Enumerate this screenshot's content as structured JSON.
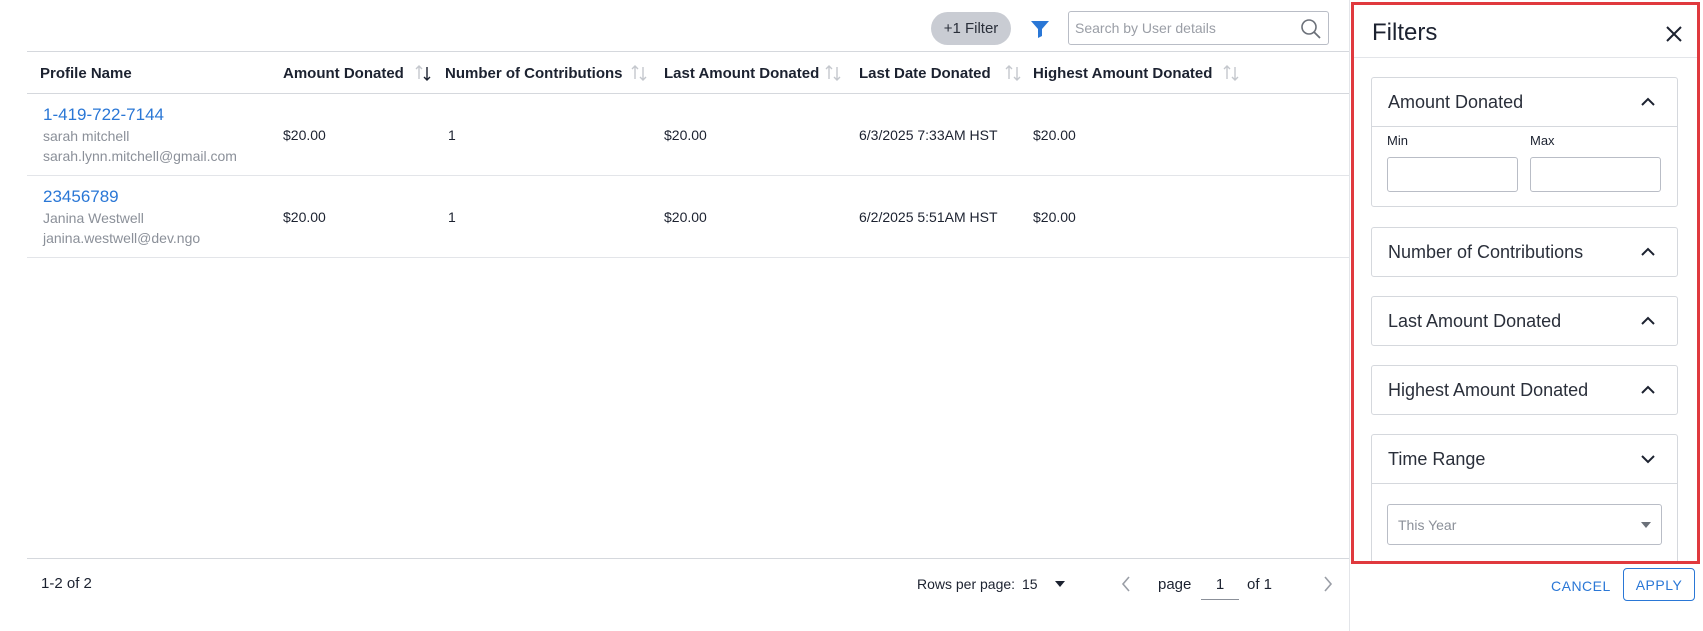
{
  "toolbar": {
    "filter_chip": "+1 Filter",
    "search_placeholder": "Search by User details"
  },
  "table": {
    "columns": [
      "Profile Name",
      "Amount Donated",
      "Number of Contributions",
      "Last Amount Donated",
      "Last Date Donated",
      "Highest Amount Donated"
    ],
    "rows": [
      {
        "profile_id": "1-419-722-7144",
        "name": "sarah mitchell",
        "email": "sarah.lynn.mitchell@gmail.com",
        "amount_donated": "$20.00",
        "contributions": "1",
        "last_amount": "$20.00",
        "last_date": "6/3/2025 7:33AM HST",
        "highest_amount": "$20.00"
      },
      {
        "profile_id": "23456789",
        "name": "Janina Westwell",
        "email": "janina.westwell@dev.ngo",
        "amount_donated": "$20.00",
        "contributions": "1",
        "last_amount": "$20.00",
        "last_date": "6/2/2025 5:51AM HST",
        "highest_amount": "$20.00"
      }
    ]
  },
  "footer": {
    "count": "1-2 of 2",
    "rows_per_page_label": "Rows per page:",
    "rows_per_page_value": "15",
    "page_label": "page",
    "page_value": "1",
    "of_label": "of 1"
  },
  "filters": {
    "title": "Filters",
    "sections": [
      {
        "label": "Amount Donated",
        "expanded": true
      },
      {
        "label": "Number of Contributions",
        "expanded": true
      },
      {
        "label": "Last Amount Donated",
        "expanded": true
      },
      {
        "label": "Highest Amount Donated",
        "expanded": true
      },
      {
        "label": "Time Range",
        "expanded": false
      }
    ],
    "min_label": "Min",
    "max_label": "Max",
    "time_range_value": "This Year",
    "cancel_label": "CANCEL",
    "apply_label": "APPLY"
  },
  "colors": {
    "link": "#2a77d6",
    "panel_highlight": "#e0393e",
    "chip_bg": "#c9ccd3"
  }
}
